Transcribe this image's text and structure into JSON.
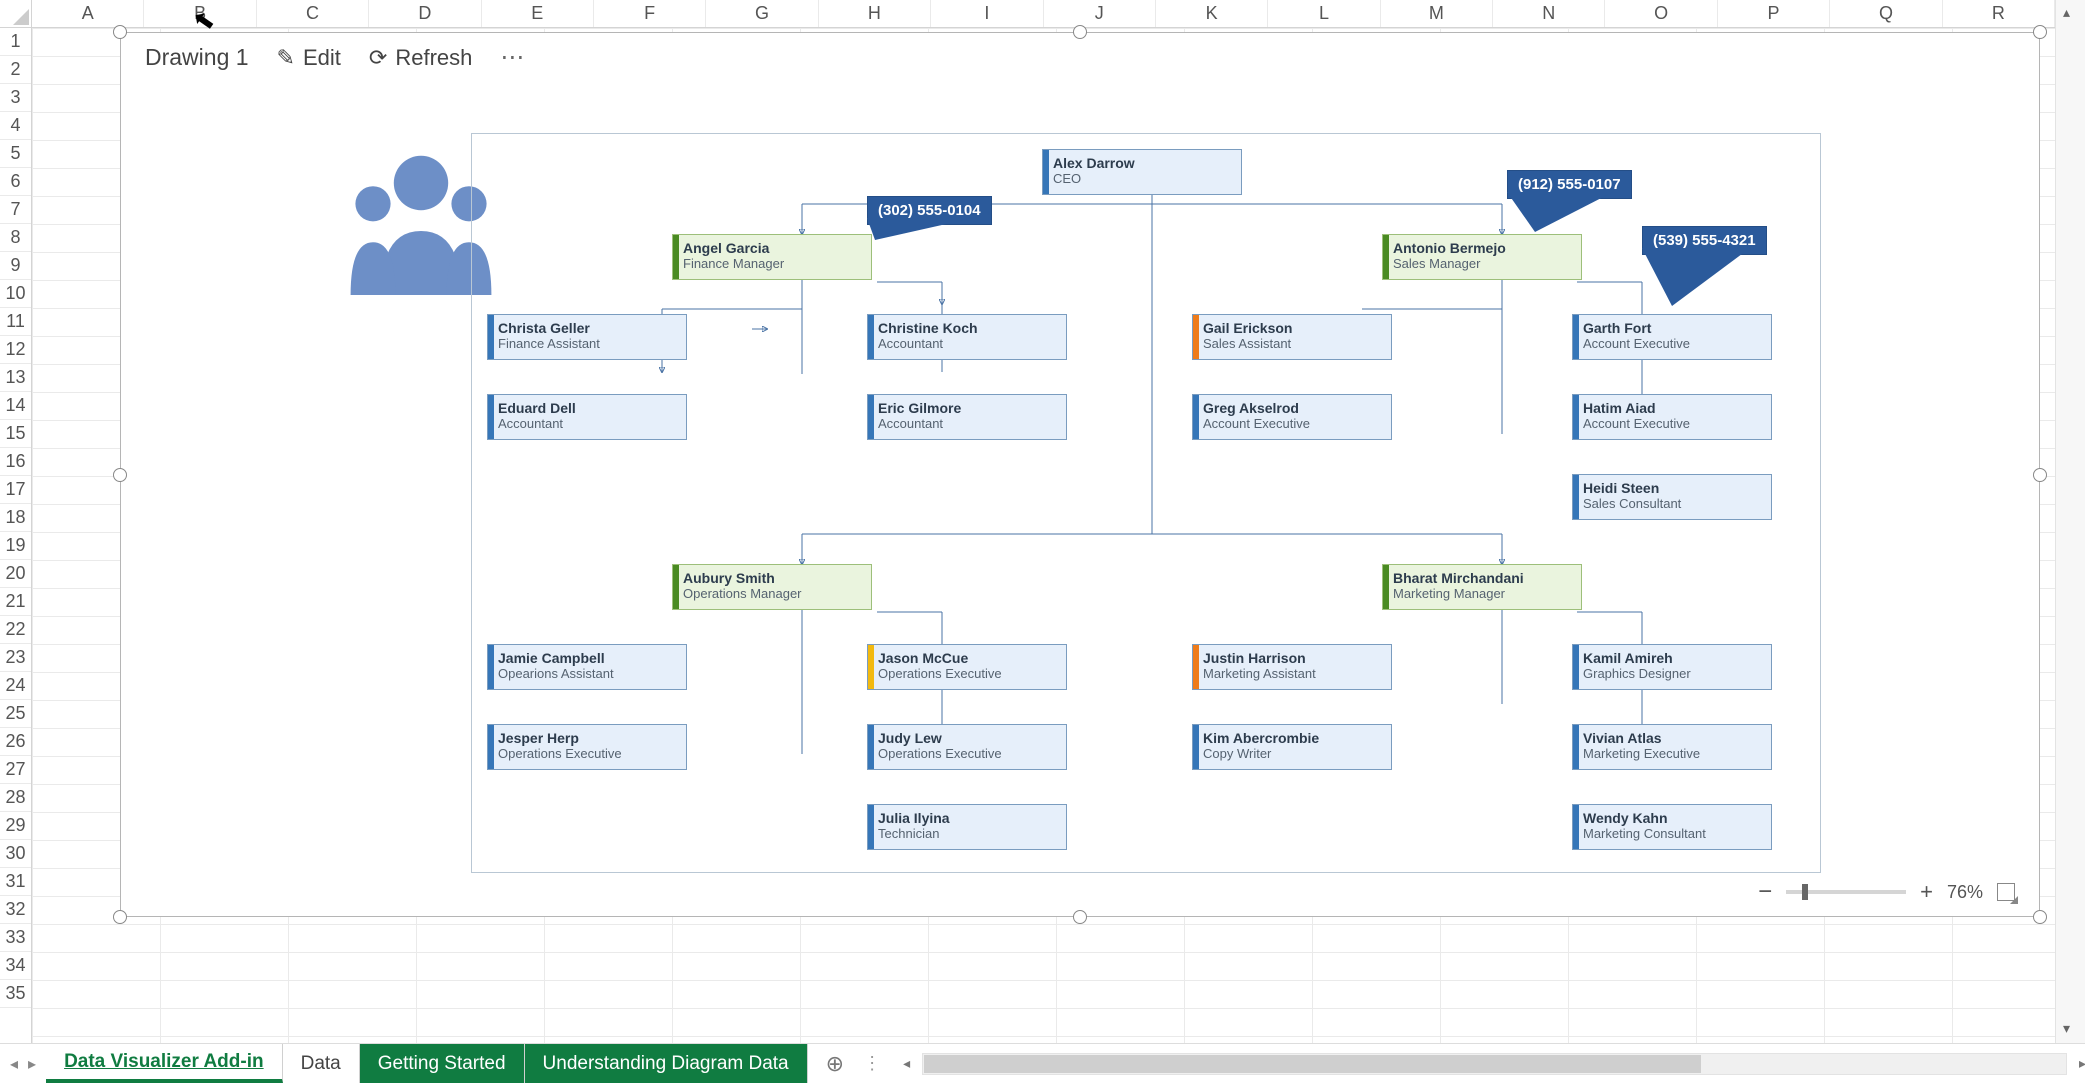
{
  "columns": [
    "A",
    "B",
    "C",
    "D",
    "E",
    "F",
    "G",
    "H",
    "I",
    "J",
    "K",
    "L",
    "M",
    "N",
    "O",
    "P",
    "Q",
    "R"
  ],
  "rows_count": 35,
  "drawing": {
    "title": "Drawing 1",
    "edit": "Edit",
    "refresh": "Refresh"
  },
  "zoom_label": "76%",
  "tabs": {
    "active": "Data Visualizer Add-in",
    "items": [
      "Data Visualizer Add-in",
      "Data",
      "Getting Started",
      "Understanding Diagram Data"
    ]
  },
  "callouts": {
    "c1": "(302) 555-0104",
    "c2": "(912) 555-0107",
    "c3": "(539) 555-4321"
  },
  "org": {
    "ceo": {
      "name": "Alex Darrow",
      "title": "CEO"
    },
    "finance_mgr": {
      "name": "Angel Garcia",
      "title": "Finance Manager"
    },
    "sales_mgr": {
      "name": "Antonio Bermejo",
      "title": "Sales Manager"
    },
    "ops_mgr": {
      "name": "Aubury Smith",
      "title": "Operations Manager"
    },
    "mkt_mgr": {
      "name": "Bharat Mirchandani",
      "title": "Marketing Manager"
    },
    "christa": {
      "name": "Christa Geller",
      "title": "Finance Assistant"
    },
    "eduard": {
      "name": "Eduard Dell",
      "title": "Accountant"
    },
    "christine": {
      "name": "Christine Koch",
      "title": "Accountant"
    },
    "eric": {
      "name": "Eric Gilmore",
      "title": "Accountant"
    },
    "gail": {
      "name": "Gail Erickson",
      "title": "Sales Assistant"
    },
    "greg": {
      "name": "Greg Akselrod",
      "title": "Account Executive"
    },
    "garth": {
      "name": "Garth Fort",
      "title": "Account Executive"
    },
    "hatim": {
      "name": "Hatim Aiad",
      "title": "Account Executive"
    },
    "heidi": {
      "name": "Heidi Steen",
      "title": "Sales Consultant"
    },
    "jamie": {
      "name": "Jamie Campbell",
      "title": "Opearions Assistant"
    },
    "jesper": {
      "name": "Jesper Herp",
      "title": "Operations Executive"
    },
    "jason": {
      "name": "Jason McCue",
      "title": "Operations Executive"
    },
    "judy": {
      "name": "Judy Lew",
      "title": "Operations Executive"
    },
    "julia": {
      "name": "Julia Ilyina",
      "title": "Technician"
    },
    "justin": {
      "name": "Justin Harrison",
      "title": "Marketing Assistant"
    },
    "kim": {
      "name": "Kim Abercrombie",
      "title": "Copy Writer"
    },
    "kamil": {
      "name": "Kamil Amireh",
      "title": "Graphics Designer"
    },
    "vivian": {
      "name": "Vivian Atlas",
      "title": "Marketing Executive"
    },
    "wendy": {
      "name": "Wendy Kahn",
      "title": "Marketing Consultant"
    }
  }
}
